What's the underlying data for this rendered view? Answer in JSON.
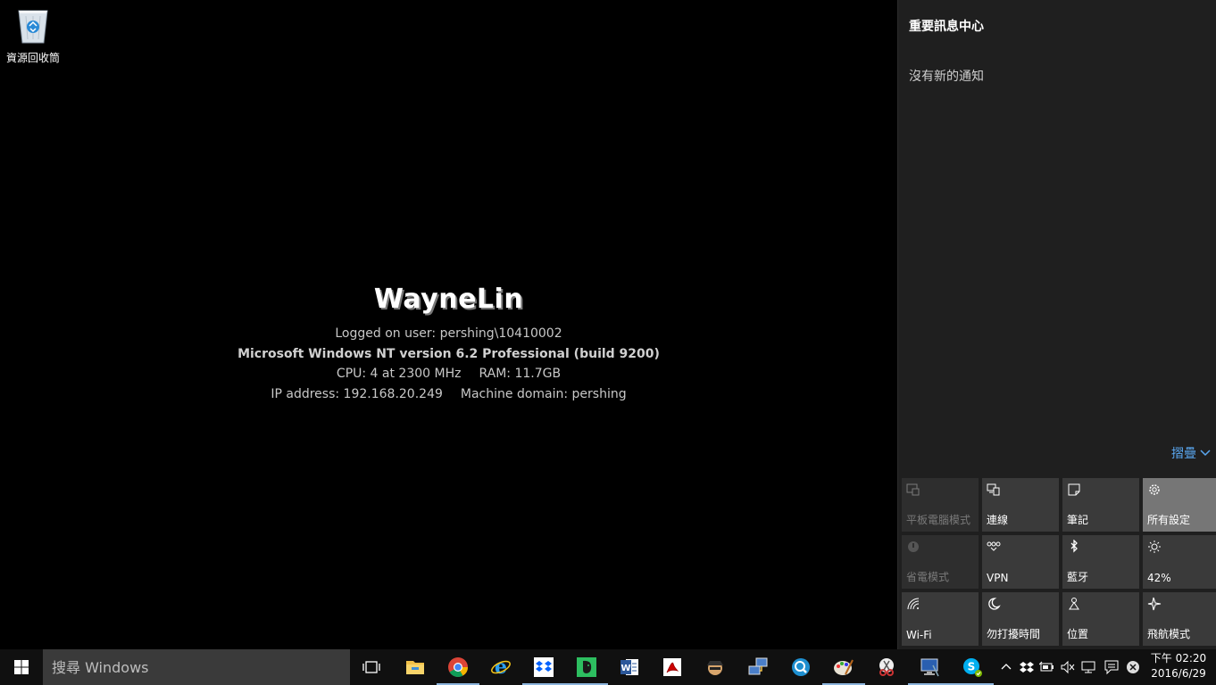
{
  "desktop": {
    "recycle_bin_label": "資源回收筒"
  },
  "bginfo": {
    "hostname": "WayneLin",
    "logged_on": "Logged on user: pershing\\10410002",
    "os": "Microsoft Windows NT version 6.2 Professional  (build 9200)",
    "cpu": "CPU: 4 at 2300 MHz",
    "ram": "RAM: 11.7GB",
    "ip": "IP address: 192.168.20.249",
    "domain": "Machine domain: pershing"
  },
  "action_center": {
    "title": "重要訊息中心",
    "empty": "沒有新的通知",
    "collapse": "摺疊",
    "tiles": [
      {
        "label": "平板電腦模式",
        "icon": "tablet-mode-icon",
        "state": "disabled"
      },
      {
        "label": "連線",
        "icon": "connect-icon",
        "state": "normal"
      },
      {
        "label": "筆記",
        "icon": "note-icon",
        "state": "normal"
      },
      {
        "label": "所有設定",
        "icon": "gear-icon",
        "state": "active"
      },
      {
        "label": "省電模式",
        "icon": "battery-saver-icon",
        "state": "disabled"
      },
      {
        "label": "VPN",
        "icon": "vpn-icon",
        "state": "normal"
      },
      {
        "label": "藍牙",
        "icon": "bluetooth-icon",
        "state": "normal"
      },
      {
        "label": "42%",
        "icon": "brightness-icon",
        "state": "normal"
      },
      {
        "label": "Wi-Fi",
        "icon": "wifi-icon",
        "state": "normal"
      },
      {
        "label": "勿打擾時間",
        "icon": "moon-icon",
        "state": "normal"
      },
      {
        "label": "位置",
        "icon": "location-icon",
        "state": "normal"
      },
      {
        "label": "飛航模式",
        "icon": "airplane-icon",
        "state": "normal"
      }
    ]
  },
  "taskbar": {
    "search_placeholder": "搜尋 Windows",
    "clock_time": "下午 02:20",
    "clock_date": "2016/6/29"
  },
  "colors": {
    "accent_link": "#5aa7f0",
    "tile_active": "#767676",
    "tile_normal": "#3a3a3a",
    "running_indicator": "#8cb4dc"
  }
}
